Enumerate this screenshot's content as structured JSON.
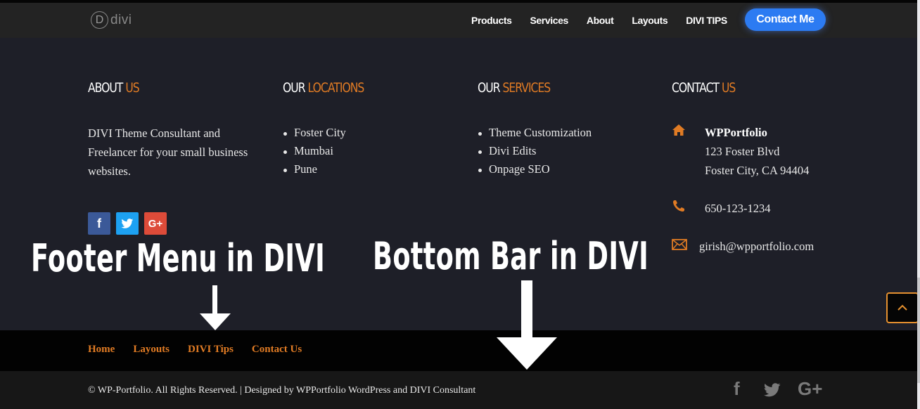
{
  "header": {
    "logo": {
      "letter": "D",
      "text": "divi"
    },
    "nav": [
      "Products",
      "Services",
      "About",
      "Layouts",
      "DIVI TIPS"
    ],
    "cta": "Contact Me"
  },
  "about": {
    "title_main": "ABOUT",
    "title_accent": "US",
    "body": "DIVI Theme Consultant and Freelancer for your small business websites.",
    "social": {
      "facebook": "f",
      "twitter": "twitter-bird",
      "google_plus": "G+"
    }
  },
  "locations": {
    "title_main": "OUR",
    "title_accent": "LOCATIONS",
    "items": [
      "Foster City",
      "Mumbai",
      "Pune"
    ]
  },
  "services": {
    "title_main": "OUR",
    "title_accent": "SERVICES",
    "items": [
      "Theme Customization",
      "Divi Edits",
      "Onpage SEO"
    ]
  },
  "contact": {
    "title_main": "CONTACT",
    "title_accent": "US",
    "name": "WPPortfolio",
    "address_line1": "123 Foster Blvd",
    "address_line2": "Foster City, CA 94404",
    "phone": "650-123-1234",
    "email": "girish@wpportfolio.com"
  },
  "annotations": {
    "footer_menu": "Footer Menu in DIVI",
    "bottom_bar": "Bottom Bar in DIVI"
  },
  "footer_menu": [
    "Home",
    "Layouts",
    "DIVI Tips",
    "Contact Us"
  ],
  "bottom_bar": {
    "copyright": "© WP-Portfolio. All Rights Reserved. | Designed by WPPortfolio WordPress and DIVI Consultant",
    "social": {
      "facebook": "f",
      "google_plus": "G+"
    }
  },
  "colors": {
    "accent": "#e07b24",
    "cta": "#2c7bf2",
    "background": "#1e1f28",
    "header": "#232323",
    "footer_menu_bg": "#020202",
    "bottom_bar_bg": "#171717"
  }
}
